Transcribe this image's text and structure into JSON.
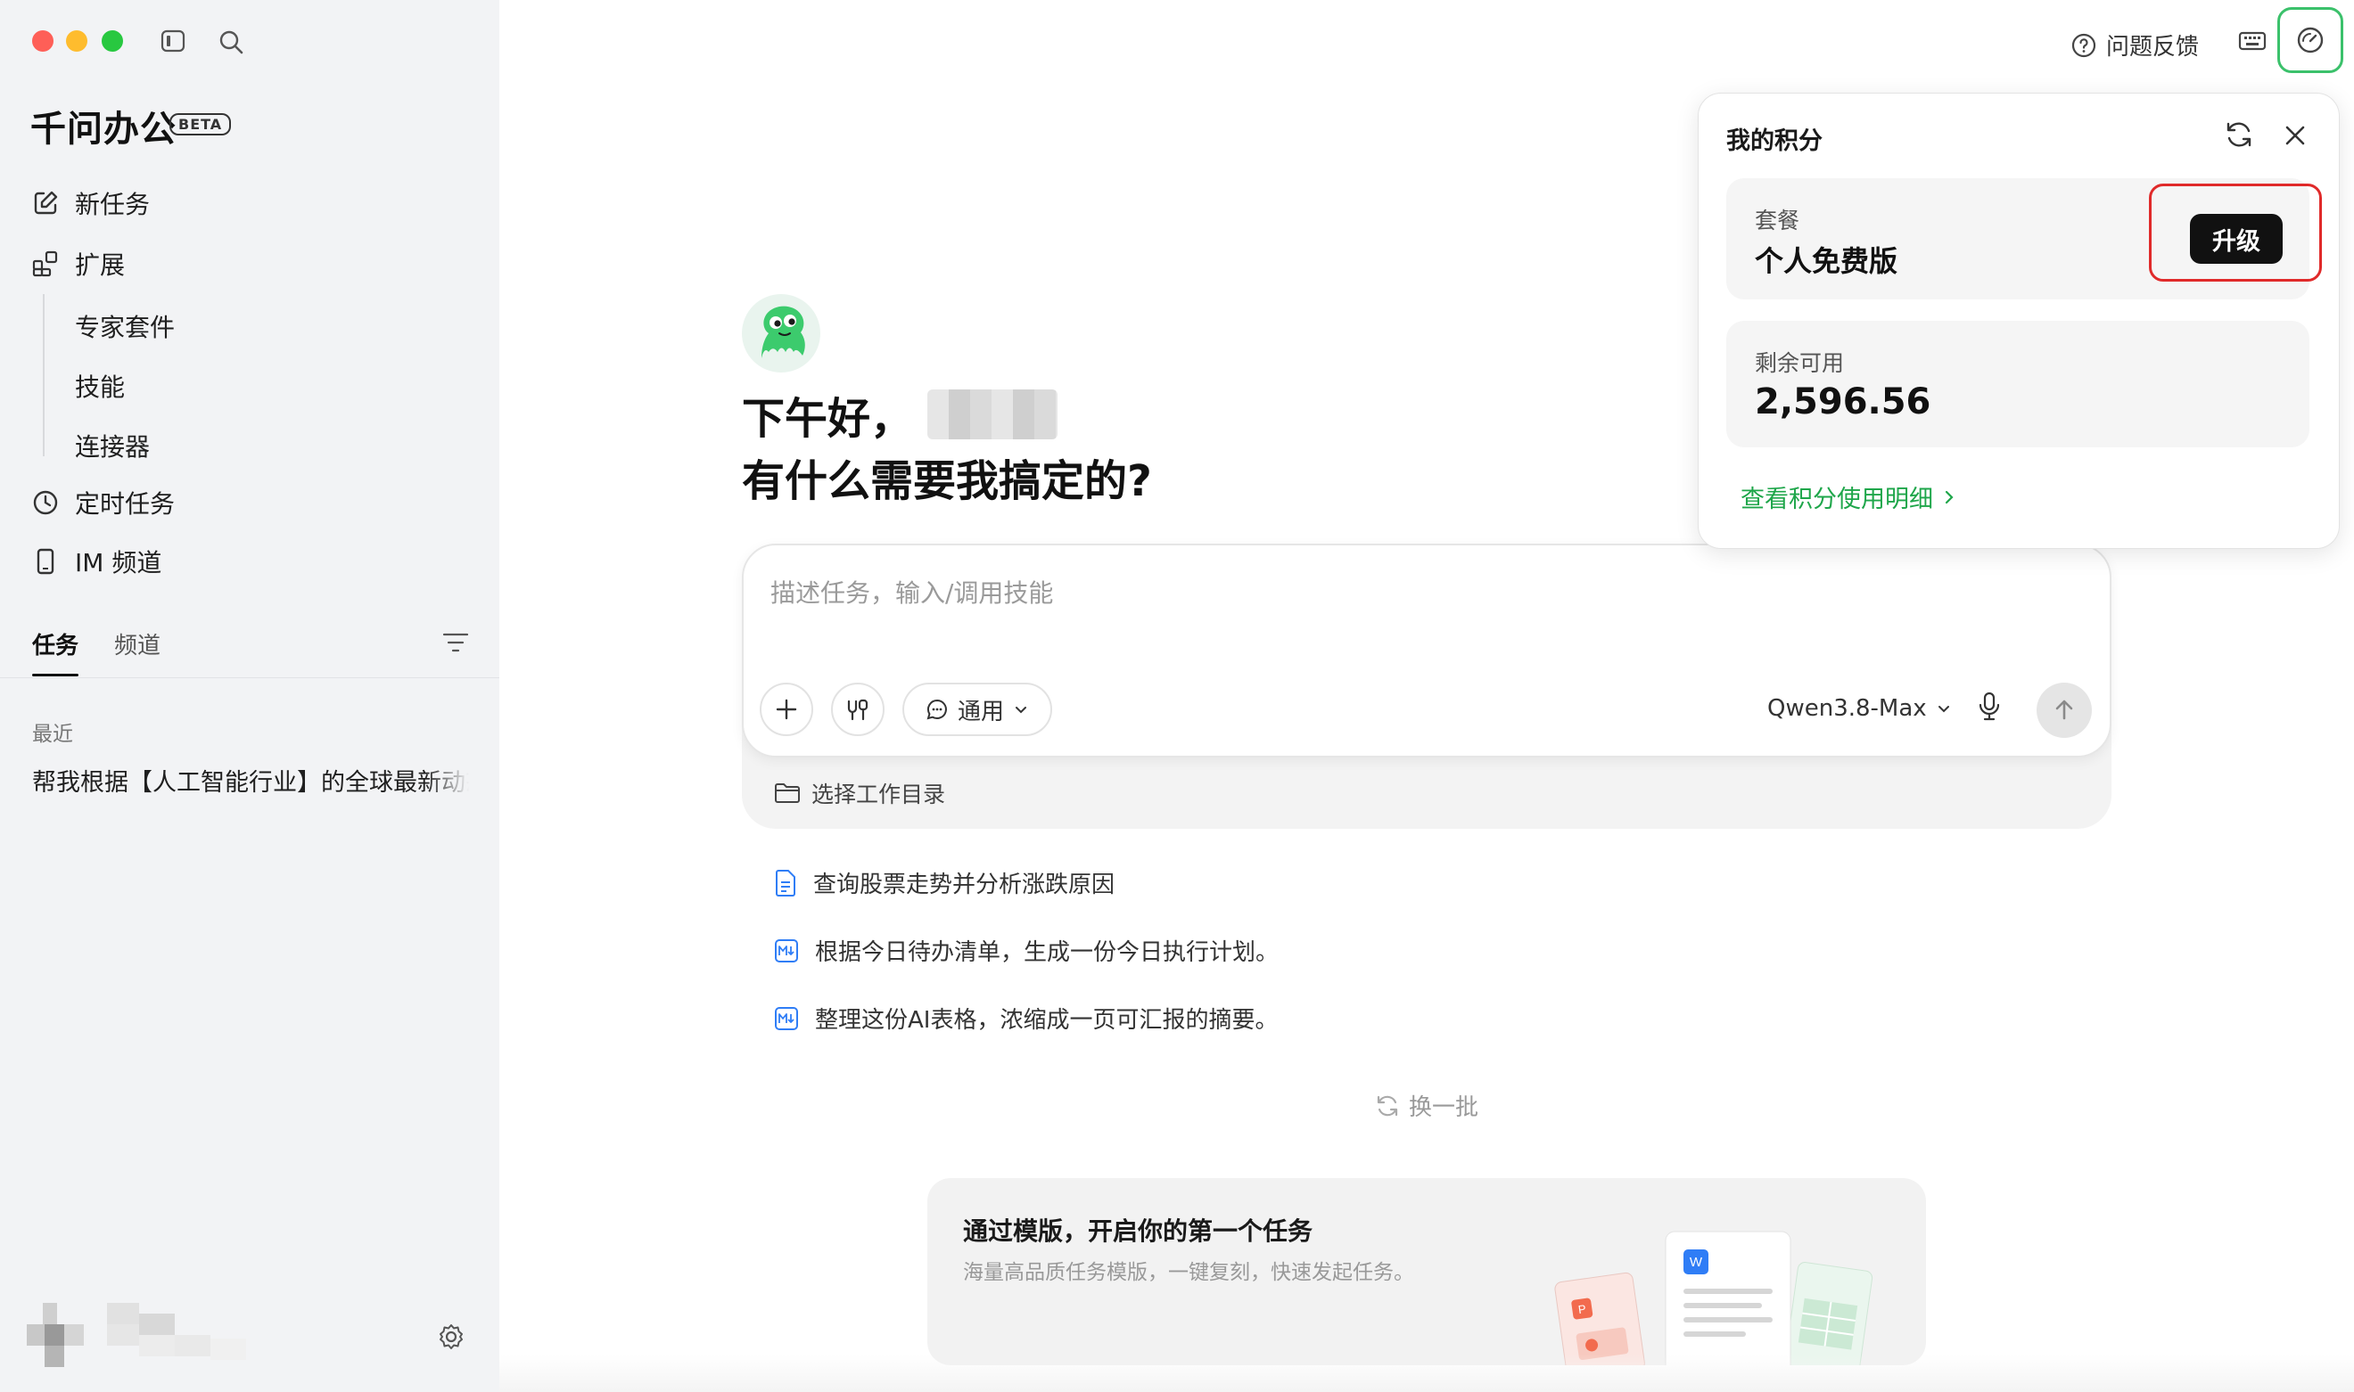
{
  "sidebar": {
    "brand": "千问办公",
    "beta": "BETA",
    "nav": {
      "new_task": "新任务",
      "extensions": "扩展",
      "expert_kit": "专家套件",
      "skills": "技能",
      "connectors": "连接器",
      "scheduled": "定时任务",
      "im_channel": "IM 频道"
    },
    "tabs": {
      "tasks": "任务",
      "channels": "频道"
    },
    "recent_label": "最近",
    "recent_items": [
      "帮我根据【人工智能行业】的全球最新动态"
    ]
  },
  "topbar": {
    "feedback": "问题反馈"
  },
  "main": {
    "greeting": "下午好，",
    "question": "有什么需要我搞定的?",
    "input_placeholder": "描述任务，输入/调用技能",
    "mode_label": "通用",
    "model": "Qwen3.8-Max",
    "workdir": "选择工作目录",
    "suggestions": [
      "查询股票走势并分析涨跌原因",
      "根据今日待办清单，生成一份今日执行计划。",
      "整理这份AI表格，浓缩成一页可汇报的摘要。"
    ],
    "refresh_label": "换一批",
    "template_title": "通过模版，开启你的第一个任务",
    "template_desc": "海量高品质任务模版，一键复刻，快速发起任务。",
    "template_doc_letters": {
      "word": "W",
      "ppt": "P"
    }
  },
  "points_popup": {
    "title": "我的积分",
    "plan_label": "套餐",
    "plan_value": "个人免费版",
    "upgrade": "升级",
    "remain_label": "剩余可用",
    "remain_value": "2,596.56",
    "detail_link": "查看积分使用明细"
  },
  "colors": {
    "accent_green": "#1ea64a",
    "highlight_red": "#e02a2a",
    "focus_green": "#3bc16b"
  }
}
